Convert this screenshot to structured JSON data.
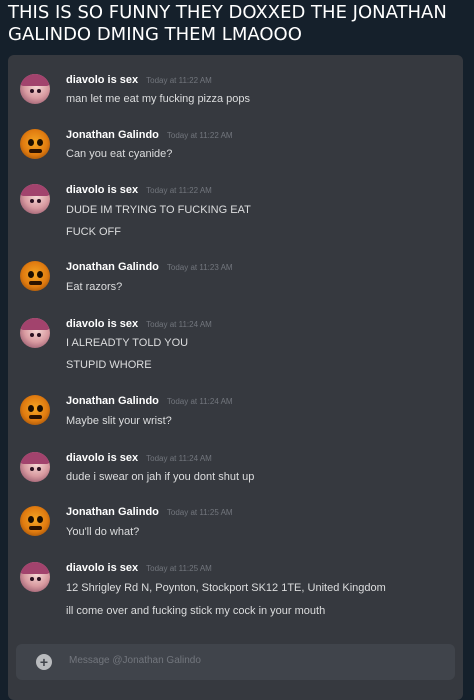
{
  "caption": "THIS IS SO FUNNY THEY DOXXED THE JONATHAN GALINDO DMING THEM LMAOOO",
  "messages": [
    {
      "author": "diavolo is sex",
      "time": "Today at 11:22 AM",
      "lines": [
        "man let me eat my fucking pizza pops"
      ]
    },
    {
      "author": "Jonathan Galindo",
      "time": "Today at 11:22 AM",
      "lines": [
        "Can you eat cyanide?"
      ]
    },
    {
      "author": "diavolo is sex",
      "time": "Today at 11:22 AM",
      "lines": [
        "DUDE IM TRYING TO FUCKING EAT",
        "FUCK OFF"
      ]
    },
    {
      "author": "Jonathan Galindo",
      "time": "Today at 11:23 AM",
      "lines": [
        "Eat razors?"
      ]
    },
    {
      "author": "diavolo is sex",
      "time": "Today at 11:24 AM",
      "lines": [
        "I ALREADTY TOLD YOU",
        "STUPID WHORE"
      ]
    },
    {
      "author": "Jonathan Galindo",
      "time": "Today at 11:24 AM",
      "lines": [
        "Maybe slit your wrist?"
      ]
    },
    {
      "author": "diavolo is sex",
      "time": "Today at 11:24 AM",
      "lines": [
        "dude i swear on jah if you dont shut up"
      ]
    },
    {
      "author": "Jonathan Galindo",
      "time": "Today at 11:25 AM",
      "lines": [
        "You'll do what?"
      ]
    },
    {
      "author": "diavolo is sex",
      "time": "Today at 11:25 AM",
      "lines": [
        "12 Shrigley Rd N, Poynton, Stockport SK12 1TE, United Kingdom",
        "ill come over and fucking stick my cock in your mouth"
      ]
    }
  ],
  "composer": {
    "placeholder": "Message @Jonathan Galindo",
    "plus_icon": "plus-circle-icon"
  },
  "colors": {
    "panel": "#36393f",
    "text": "#dcddde",
    "timestamp": "#72767d",
    "page": "#15202b"
  }
}
